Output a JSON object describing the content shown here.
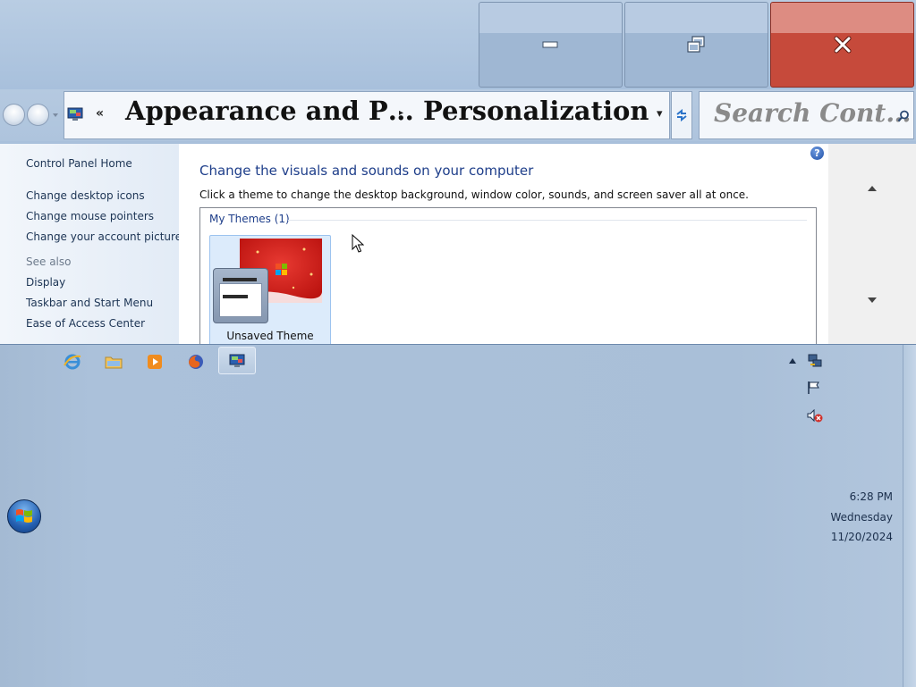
{
  "window": {
    "caption_buttons": {
      "minimize": "minimize",
      "maximize": "restore",
      "close": "close"
    },
    "colors": {
      "close": "#c64a3b",
      "accent_link": "#1e5aa8",
      "heading": "#1e3e8a"
    }
  },
  "address_bar": {
    "overflow_glyph": "«",
    "crumbs": [
      "Appearance and P…",
      "Personalization"
    ],
    "separator": "▸",
    "dropdown_glyph": "▾"
  },
  "search": {
    "placeholder": "Search Cont…"
  },
  "left_pane": {
    "home": "Control Panel Home",
    "tasks": [
      "Change desktop icons",
      "Change mouse pointers",
      "Change your account picture"
    ],
    "see_also_label": "See also",
    "see_also": [
      "Display",
      "Taskbar and Start Menu",
      "Ease of Access Center"
    ]
  },
  "main": {
    "heading": "Change the visuals and sounds on your computer",
    "description": "Click a theme to change the desktop background, window color, sounds, and screen saver all at once.",
    "group_label": "My Themes (1)",
    "themes": [
      {
        "name": "Unsaved Theme",
        "selected": true
      }
    ],
    "help_glyph": "?"
  },
  "taskbar": {
    "pinned": [
      "internet-explorer-icon",
      "windows-explorer-icon",
      "media-player-icon",
      "firefox-icon",
      "control-panel-icon"
    ],
    "active": "control-panel-icon",
    "tray": [
      "show-hidden-icons",
      "network-icon",
      "action-center-flag-icon",
      "volume-muted-icon"
    ]
  },
  "clock": {
    "time": "6:28 PM",
    "day": "Wednesday",
    "date": "11/20/2024"
  }
}
